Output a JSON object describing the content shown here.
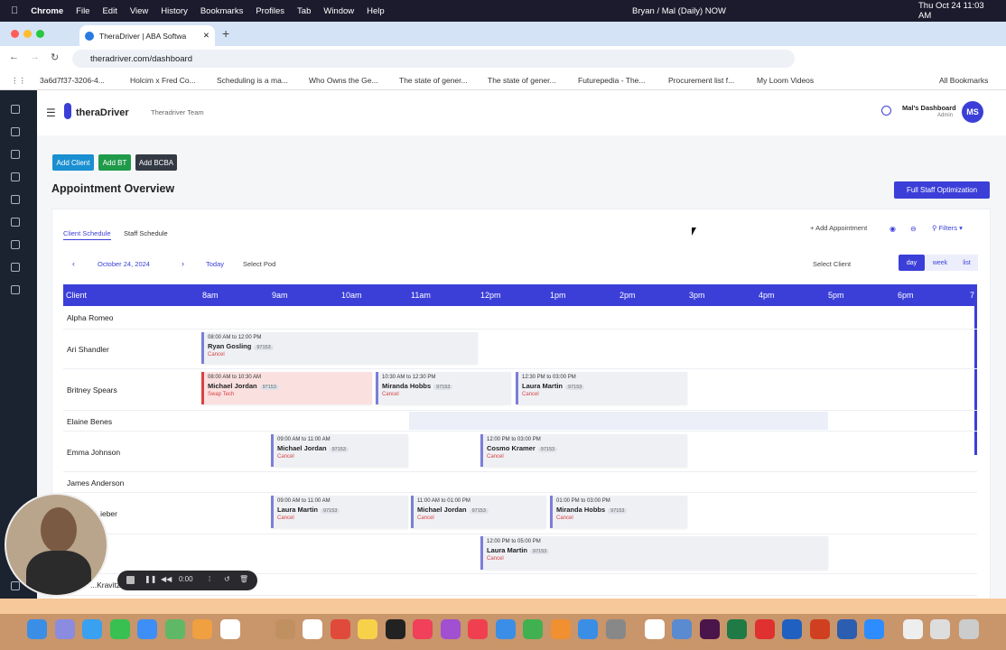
{
  "menubar": {
    "apple": "",
    "items": [
      "Chrome",
      "File",
      "Edit",
      "View",
      "History",
      "Bookmarks",
      "Profiles",
      "Tab",
      "Window",
      "Help"
    ],
    "status": "Bryan / Mal (Daily) NOW",
    "datetime": "Thu Oct 24  11:03 AM"
  },
  "browser": {
    "tab_title": "TheraDriver | ABA Softwa",
    "url": "theradriver.com/dashboard",
    "bookmarks": [
      "3a6d7f37-3206-4...",
      "Holcim x Fred Co...",
      "Scheduling is a ma...",
      "Who Owns the Ge...",
      "The state of gener...",
      "The state of gener...",
      "Futurepedia - The...",
      "Procurement list f...",
      "My Loom Videos"
    ],
    "all_bookmarks": "All Bookmarks"
  },
  "app": {
    "logo": "theraDriver",
    "team": "Theradriver Team",
    "user_name": "Mal's Dashboard",
    "user_role": "Admin",
    "avatar": "MS",
    "buttons": {
      "add_client": "Add Client",
      "add_bt": "Add BT",
      "add_bcba": "Add BCBA",
      "optimize": "Full Staff Optimization"
    },
    "page_title": "Appointment Overview",
    "tabs": [
      "Client Schedule",
      "Staff Schedule"
    ],
    "toolbar": {
      "add_appt": "Add Appointment",
      "filters": "Filters",
      "date": "October 24, 2024",
      "today": "Today",
      "pod": "Select Pod",
      "client": "Select Client",
      "views": [
        "day",
        "week",
        "list"
      ]
    },
    "colors": {
      "accent": "#3b3fd8",
      "add_client": "#1a8fd1",
      "add_bt": "#1f9a4a",
      "add_bcba": "#333a44"
    },
    "grid": {
      "client_header": "Client",
      "hours": [
        "8am",
        "9am",
        "10am",
        "11am",
        "12pm",
        "1pm",
        "2pm",
        "3pm",
        "4pm",
        "5pm",
        "6pm",
        "7"
      ],
      "rows": [
        "Alpha Romeo",
        "Ari Shandler",
        "Britney Spears",
        "Elaine Benes",
        "Emma Johnson",
        "James Anderson",
        "...ieber",
        "",
        "...Kravitz"
      ]
    },
    "appointments": [
      {
        "time": "08:00 AM to 12:00 PM",
        "name": "Ryan Gosling",
        "badge": "97153",
        "action": "Cancel"
      },
      {
        "time": "08:00 AM to 10:30 AM",
        "name": "Michael Jordan",
        "badge": "97153",
        "action": "Swap Tech"
      },
      {
        "time": "10:30 AM to 12:30 PM",
        "name": "Miranda Hobbs",
        "badge": "97153",
        "action": "Cancel"
      },
      {
        "time": "12:30 PM to 03:00 PM",
        "name": "Laura Martin",
        "badge": "97153",
        "action": "Cancel"
      },
      {
        "time": "09:00 AM to 11:00 AM",
        "name": "Michael Jordan",
        "badge": "97153",
        "action": "Cancel"
      },
      {
        "time": "12:00 PM to 03:00 PM",
        "name": "Cosmo Kramer",
        "badge": "97153",
        "action": "Cancel"
      },
      {
        "time": "09:00 AM to 11:00 AM",
        "name": "Laura Martin",
        "badge": "97153",
        "action": "Cancel"
      },
      {
        "time": "11:00 AM to 01:00 PM",
        "name": "Michael Jordan",
        "badge": "97153",
        "action": "Cancel"
      },
      {
        "time": "01:00 PM to 03:00 PM",
        "name": "Miranda Hobbs",
        "badge": "97153",
        "action": "Cancel"
      },
      {
        "time": "12:00 PM to 05:00 PM",
        "name": "Laura Martin",
        "badge": "97153",
        "action": "Cancel"
      }
    ]
  },
  "recorder": {
    "time": "0:00"
  }
}
